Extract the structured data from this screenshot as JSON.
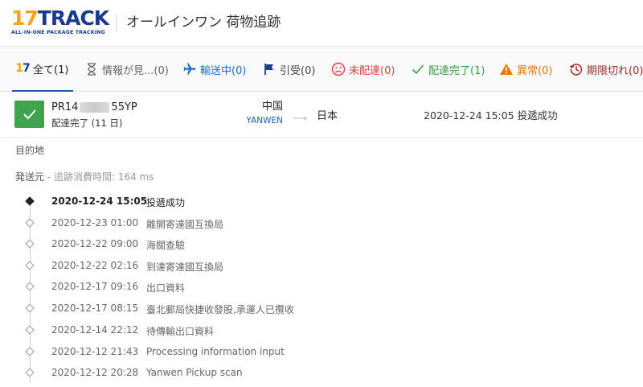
{
  "header": {
    "logo_text_17": "17",
    "logo_text_track": "TRACK",
    "logo_tagline": "ALL-IN-ONE PACKAGE TRACKING",
    "title": "オールインワン 荷物追跡"
  },
  "tabs": [
    {
      "label": "全て(1)",
      "icon": "17track-icon",
      "active": true
    },
    {
      "label": "情報が見...(0)",
      "icon": "hourglass-icon"
    },
    {
      "label": "輸送中(0)",
      "icon": "airplane-icon"
    },
    {
      "label": "引受(0)",
      "icon": "flag-icon"
    },
    {
      "label": "未配達(0)",
      "icon": "sad-face-icon"
    },
    {
      "label": "配達完了(1)",
      "icon": "check-icon"
    },
    {
      "label": "異常(0)",
      "icon": "warning-icon"
    },
    {
      "label": "期限切れ(0)",
      "icon": "history-clock-icon"
    }
  ],
  "package": {
    "number_prefix": "PR14",
    "number_suffix": "55YP",
    "status": "配達完了 (11 日)",
    "origin_country": "中国",
    "carrier": "YANWEN",
    "destination_country": "日本",
    "latest_event": "2020-12-24 15:05  投遞成功",
    "status_color": "#3fa34d"
  },
  "sections": {
    "destination_label": "目的地",
    "origin_label": "発送元",
    "elapsed_separator": " - ",
    "elapsed_text": "追跡消費時間: 164 ms"
  },
  "events": [
    {
      "time": "2020-12-24 15:05",
      "desc": "投遞成功"
    },
    {
      "time": "2020-12-23 01:00",
      "desc": "離開寄達國互換局"
    },
    {
      "time": "2020-12-22 09:00",
      "desc": "海關查驗"
    },
    {
      "time": "2020-12-22 02:16",
      "desc": "到達寄達國互換局"
    },
    {
      "time": "2020-12-17 09:16",
      "desc": "出口資料"
    },
    {
      "time": "2020-12-17 08:15",
      "desc": "臺北郵局快捷收發股,承運人已攬收"
    },
    {
      "time": "2020-12-14 22:12",
      "desc": "待傳輸出口資料"
    },
    {
      "time": "2020-12-12 21:43",
      "desc": "Processing information input"
    },
    {
      "time": "2020-12-12 20:28",
      "desc": "Yanwen Pickup scan"
    }
  ],
  "colors": {
    "brand_orange": "#f5a31a",
    "brand_navy": "#1a3a8f",
    "transit_blue": "#1e6fc8",
    "undelivered_red": "#e03d3d",
    "delivered_green": "#3a9a45",
    "alert_orange": "#e3780c",
    "expired_red": "#9e2b2b"
  }
}
